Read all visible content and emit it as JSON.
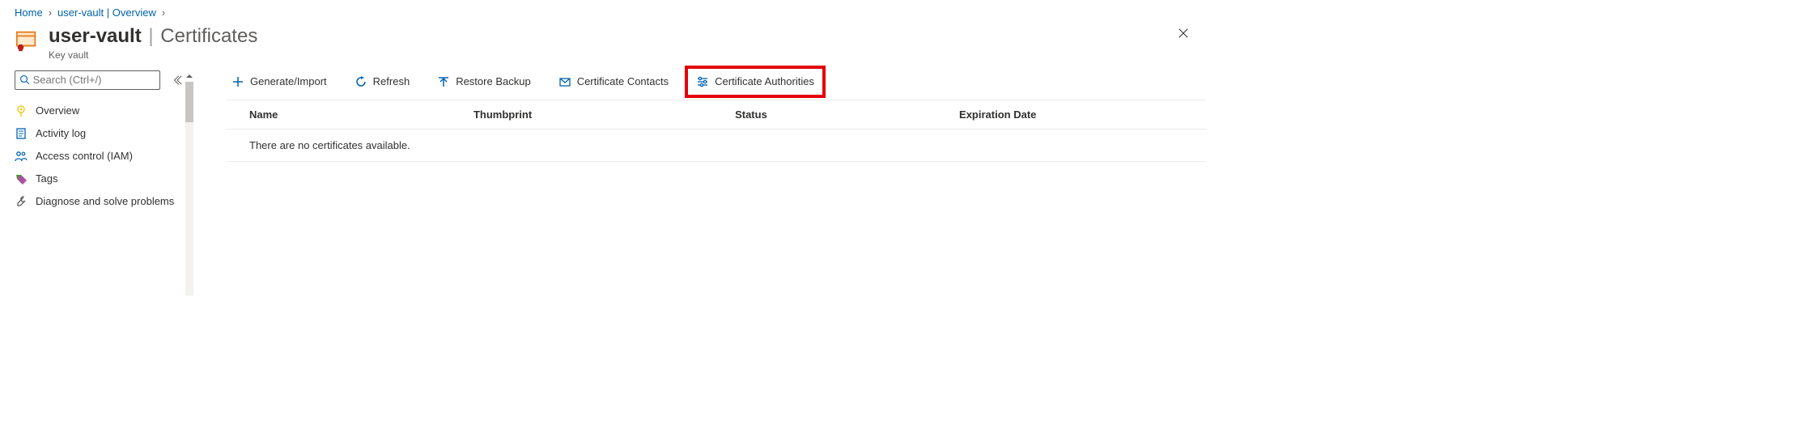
{
  "breadcrumb": {
    "home": "Home",
    "current": "user-vault | Overview"
  },
  "header": {
    "resource_name": "user-vault",
    "section": "Certificates",
    "subtitle": "Key vault"
  },
  "sidebar": {
    "search_placeholder": "Search (Ctrl+/)",
    "items": [
      {
        "label": "Overview"
      },
      {
        "label": "Activity log"
      },
      {
        "label": "Access control (IAM)"
      },
      {
        "label": "Tags"
      },
      {
        "label": "Diagnose and solve problems"
      }
    ]
  },
  "toolbar": {
    "generate_import": "Generate/Import",
    "refresh": "Refresh",
    "restore_backup": "Restore Backup",
    "certificate_contacts": "Certificate Contacts",
    "certificate_authorities": "Certificate Authorities"
  },
  "table": {
    "headers": {
      "name": "Name",
      "thumbprint": "Thumbprint",
      "status": "Status",
      "expiration": "Expiration Date"
    },
    "empty_message": "There are no certificates available."
  },
  "colors": {
    "link": "#0063b1",
    "highlight_border": "#e3000b"
  }
}
